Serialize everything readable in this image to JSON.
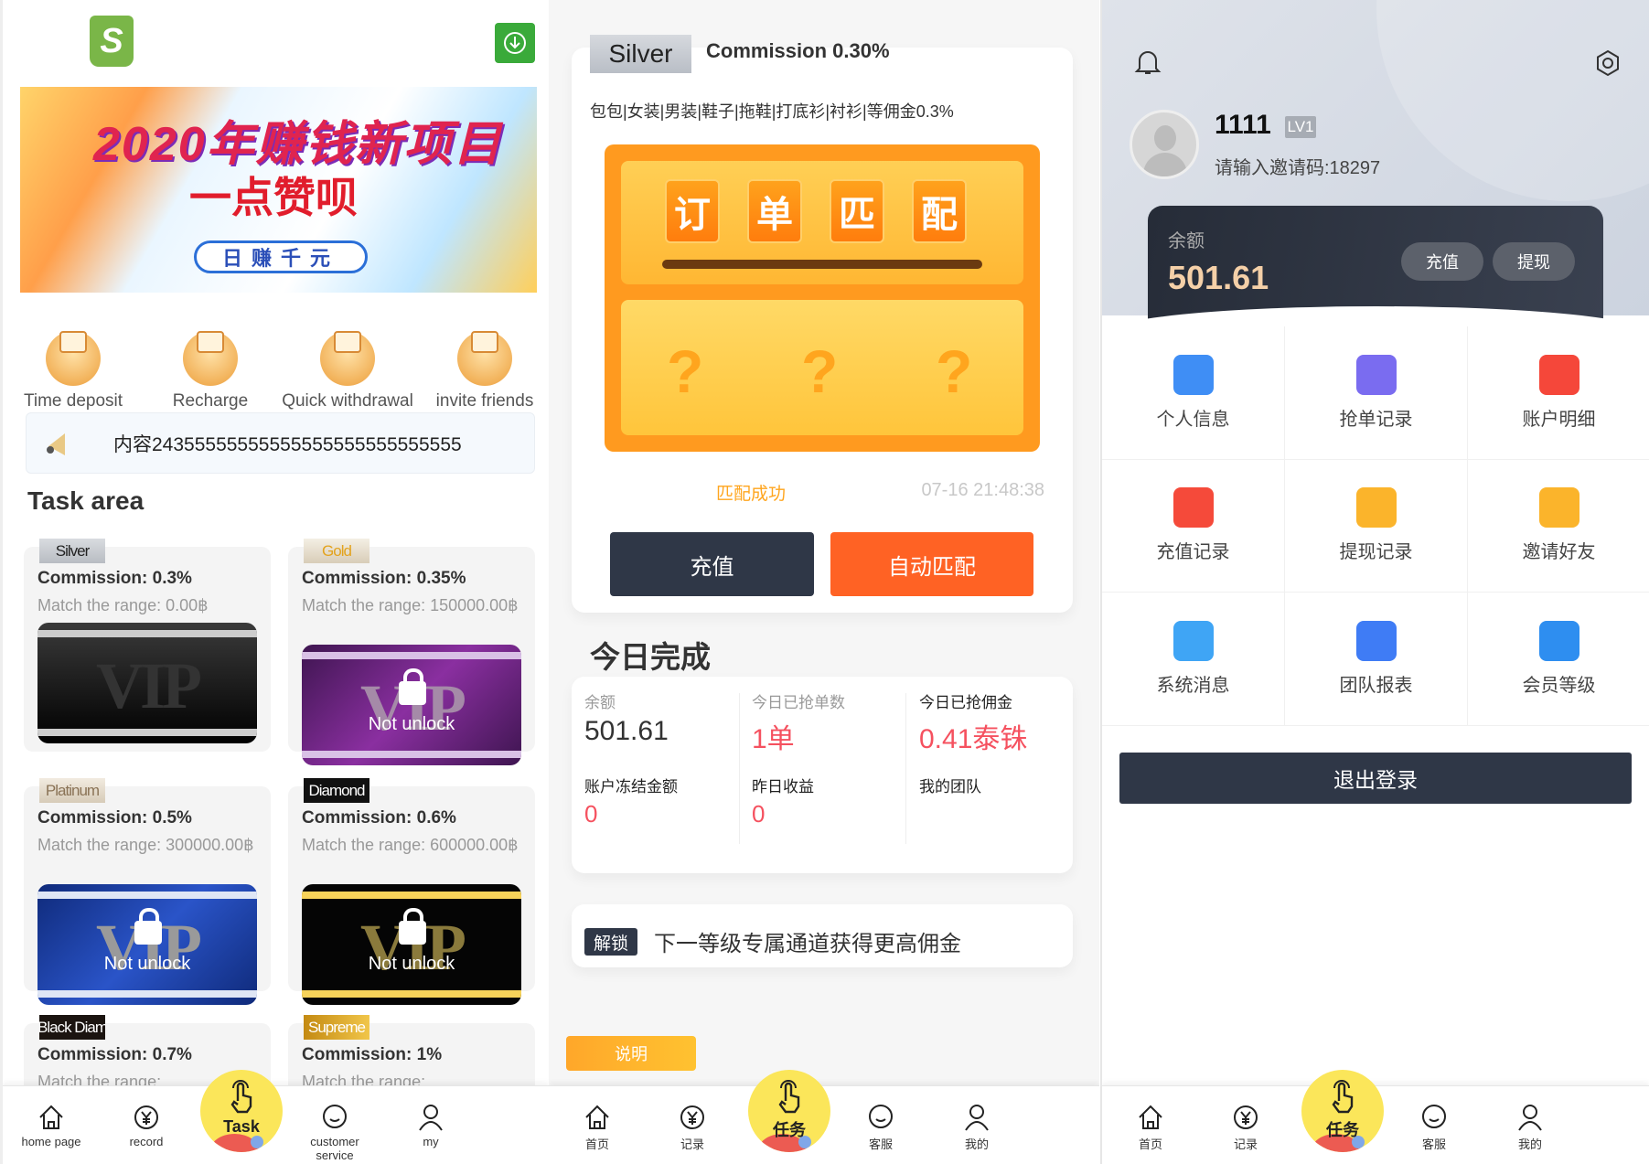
{
  "home": {
    "banner": {
      "line1": "2020年赚钱新项目",
      "line2": "一点赞呗",
      "line3": "日赚千元"
    },
    "quick_actions": [
      {
        "label": "Time deposit",
        "icon": "time-deposit-icon"
      },
      {
        "label": "Recharge",
        "icon": "wallet-icon"
      },
      {
        "label": "Quick withdrawal",
        "icon": "coin-icon"
      },
      {
        "label": "invite friends",
        "icon": "gift-box-icon"
      }
    ],
    "notice": "内容24355555555555555555555555555",
    "task_area_title": "Task area",
    "not_unlock_label": "Not unlock",
    "levels": [
      {
        "badge": "Silver",
        "commission": "Commission:  0.3%",
        "range": "Match the range:  0.00฿",
        "locked": false
      },
      {
        "badge": "Gold",
        "commission": "Commission:  0.35%",
        "range": "Match the range:  150000.00฿",
        "locked": true
      },
      {
        "badge": "Platinum",
        "commission": "Commission:  0.5%",
        "range": "Match the range:  300000.00฿",
        "locked": true
      },
      {
        "badge": "Diamond",
        "commission": "Commission:  0.6%",
        "range": "Match the range:  600000.00฿",
        "locked": true
      },
      {
        "badge": "Black Diam",
        "commission": "Commission:  0.7%",
        "range": "Match the range:",
        "locked": true
      },
      {
        "badge": "Supreme",
        "commission": "Commission:  1%",
        "range": "Match the range:",
        "locked": true
      }
    ],
    "nav": {
      "items": [
        "home page",
        "record",
        "Task",
        "customer service",
        "my"
      ]
    }
  },
  "match": {
    "badge": "Silver",
    "commission": "Commission 0.30%",
    "categories": "包包|女装|男装|鞋子|拖鞋|打底衫|衬衫|等佣金0.3%",
    "machine_chars": [
      "订",
      "单",
      "匹",
      "配"
    ],
    "slots": [
      "?",
      "?",
      "?"
    ],
    "status": "匹配成功",
    "timestamp": "07-16 21:48:38",
    "recharge_button": "充值",
    "auto_match_button": "自动匹配",
    "today_title": "今日完成",
    "stats": [
      {
        "label": "余额",
        "value": "501.61"
      },
      {
        "label": "今日已抢单数",
        "value": "1单"
      },
      {
        "label": "今日已抢佣金",
        "value": "0.41泰铢"
      },
      {
        "label": "账户冻结金额",
        "value": "0"
      },
      {
        "label": "昨日收益",
        "value": "0"
      },
      {
        "label": "我的团队",
        "value": ""
      }
    ],
    "unlock_tag": "解锁",
    "unlock_text": "下一等级专属通道获得更高佣金",
    "explain_button": "说明",
    "nav": {
      "items": [
        "首页",
        "记录",
        "任务",
        "客服",
        "我的"
      ]
    }
  },
  "profile": {
    "username": "1111",
    "level": "LV1",
    "invite": "请输入邀请码:18297",
    "balance_label": "余额",
    "balance": "501.61",
    "recharge": "充值",
    "withdraw": "提现",
    "menu": [
      {
        "label": "个人信息",
        "icon": "id-card-icon",
        "color": "#3f8ef5"
      },
      {
        "label": "抢单记录",
        "icon": "document-icon",
        "color": "#7a6cf0"
      },
      {
        "label": "账户明细",
        "icon": "money-bill-icon",
        "color": "#f5473a"
      },
      {
        "label": "充值记录",
        "icon": "money-bag-icon",
        "color": "#f54a3a"
      },
      {
        "label": "提现记录",
        "icon": "wallet-icon",
        "color": "#fbb42b"
      },
      {
        "label": "邀请好友",
        "icon": "gift-icon",
        "color": "#fbb42b"
      },
      {
        "label": "系统消息",
        "icon": "chat-icon",
        "color": "#3fa5f5"
      },
      {
        "label": "团队报表",
        "icon": "layers-icon",
        "color": "#3f7cf5"
      },
      {
        "label": "会员等级",
        "icon": "crown-icon",
        "color": "#2e8ef0"
      }
    ],
    "logout": "退出登录",
    "nav": {
      "items": [
        "首页",
        "记录",
        "任务",
        "客服",
        "我的"
      ]
    }
  },
  "colors": {
    "accent_orange": "#ff6224",
    "dark_navy": "#2f3747",
    "red_value": "#f5515f",
    "yellow_status": "#ffa51e"
  }
}
